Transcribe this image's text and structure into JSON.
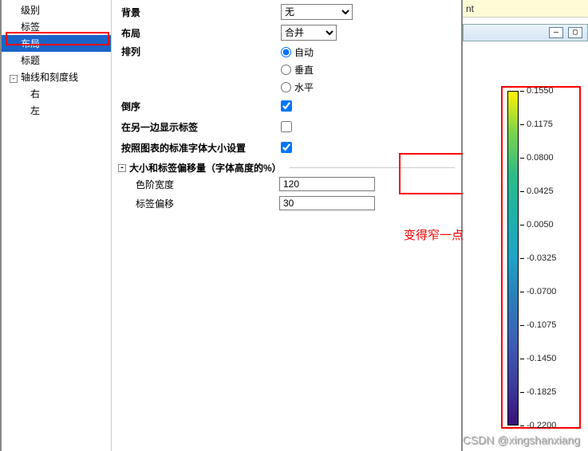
{
  "tree": {
    "items": [
      "级别",
      "标签",
      "布局",
      "标题",
      "轴线和刻度线",
      "右",
      "左"
    ]
  },
  "form": {
    "background": {
      "label": "背景",
      "value": "无"
    },
    "layout": {
      "label": "布局",
      "value": "合并"
    },
    "arrange": {
      "label": "排列",
      "opts": [
        "自动",
        "垂直",
        "水平"
      ]
    },
    "reverse": {
      "label": "倒序"
    },
    "showOther": {
      "label": "在另一边显示标签"
    },
    "followStd": {
      "label": "按照图表的标准字体大小设置"
    },
    "subHeader": "大小和标签偏移量（字体高度的%）",
    "scaleWidth": {
      "label": "色阶宽度",
      "value": "120"
    },
    "labelOffset": {
      "label": "标签偏移",
      "value": "30"
    }
  },
  "topBar": {
    "tag": "nt"
  },
  "annotation": "变得窄一点",
  "watermark": "CSDN @xingshanxiang",
  "colorbar": {
    "ticks": [
      "0.1550",
      "0.1175",
      "0.0800",
      "0.0425",
      "0.0050",
      "-0.0325",
      "-0.0700",
      "-0.1075",
      "-0.1450",
      "-0.1825",
      "-0.2200"
    ]
  }
}
